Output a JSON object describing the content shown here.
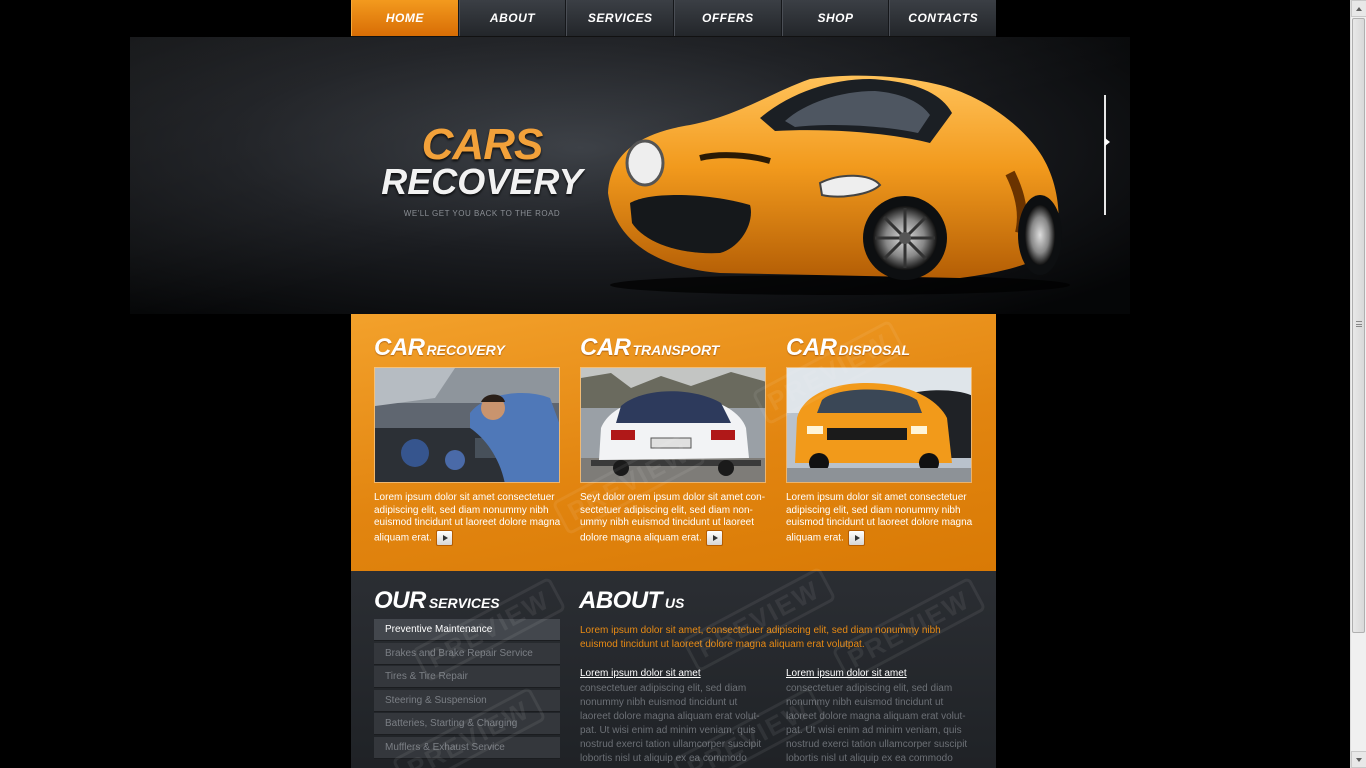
{
  "nav": {
    "items": [
      {
        "label": "HOME",
        "active": true
      },
      {
        "label": "ABOUT",
        "active": false
      },
      {
        "label": "SERVICES",
        "active": false
      },
      {
        "label": "OFFERS",
        "active": false
      },
      {
        "label": "SHOP",
        "active": false
      },
      {
        "label": "CONTACTS",
        "active": false
      }
    ]
  },
  "hero": {
    "logo_top": "CARS",
    "logo_bottom": "RECOVERY",
    "tagline": "WE'LL GET YOU BACK TO THE ROAD",
    "car_color": "#f09a1e"
  },
  "features": [
    {
      "title_big": "CAR",
      "title_small": "RECOVERY",
      "text": "Lorem ipsum dolor sit amet consectetuer adipiscing elit, sed diam nonummy nibh euismod tincidunt ut laoreet dolore magna aliquam erat."
    },
    {
      "title_big": "CAR",
      "title_small": "TRANSPORT",
      "text": "Seyt dolor orem ipsum dolor sit amet con-sectetuer adipiscing elit, sed diam non-ummy nibh euismod tincidunt ut laoreet dolore magna aliquam erat."
    },
    {
      "title_big": "CAR",
      "title_small": "DISPOSAL",
      "text": "Lorem ipsum dolor sit amet consectetuer adipiscing elit, sed diam nonummy nibh euismod tincidunt ut laoreet dolore magna aliquam erat."
    }
  ],
  "services": {
    "title_big": "OUR",
    "title_small": "SERVICES",
    "items": [
      "Preventive Maintenance",
      "Brakes and Brake Repair Service",
      "Tires & Tire Repair",
      "Steering & Suspension",
      "Batteries, Starting & Charging",
      "Mufflers & Exhaust Service"
    ],
    "active_index": 0
  },
  "about": {
    "title_big": "ABOUT",
    "title_small": "US",
    "lead": "Lorem ipsum dolor sit amet, consectetuer adipiscing elit, sed diam nonummy nibh euismod tincidunt ut laoreet dolore magna aliquam erat volutpat.",
    "columns": [
      {
        "title": "Lorem ipsum dolor sit amet",
        "text": "consectetuer adipiscing elit, sed diam nonummy nibh euismod tincidunt ut laoreet dolore magna aliquam erat volut-pat. Ut wisi enim ad minim veniam, quis nostrud exerci tation ullamcorper suscipit lobortis nisl ut aliquip ex ea commodo"
      },
      {
        "title": "Lorem ipsum dolor sit amet",
        "text": "consectetuer adipiscing elit, sed diam nonummy nibh euismod tincidunt ut laoreet dolore magna aliquam erat volut-pat. Ut wisi enim ad minim veniam, quis nostrud exerci tation ullamcorper suscipit lobortis nisl ut aliquip ex ea commodo"
      }
    ]
  },
  "watermark": "PREVIEW",
  "colors": {
    "accent": "#e8870f",
    "dark": "#23262a"
  }
}
